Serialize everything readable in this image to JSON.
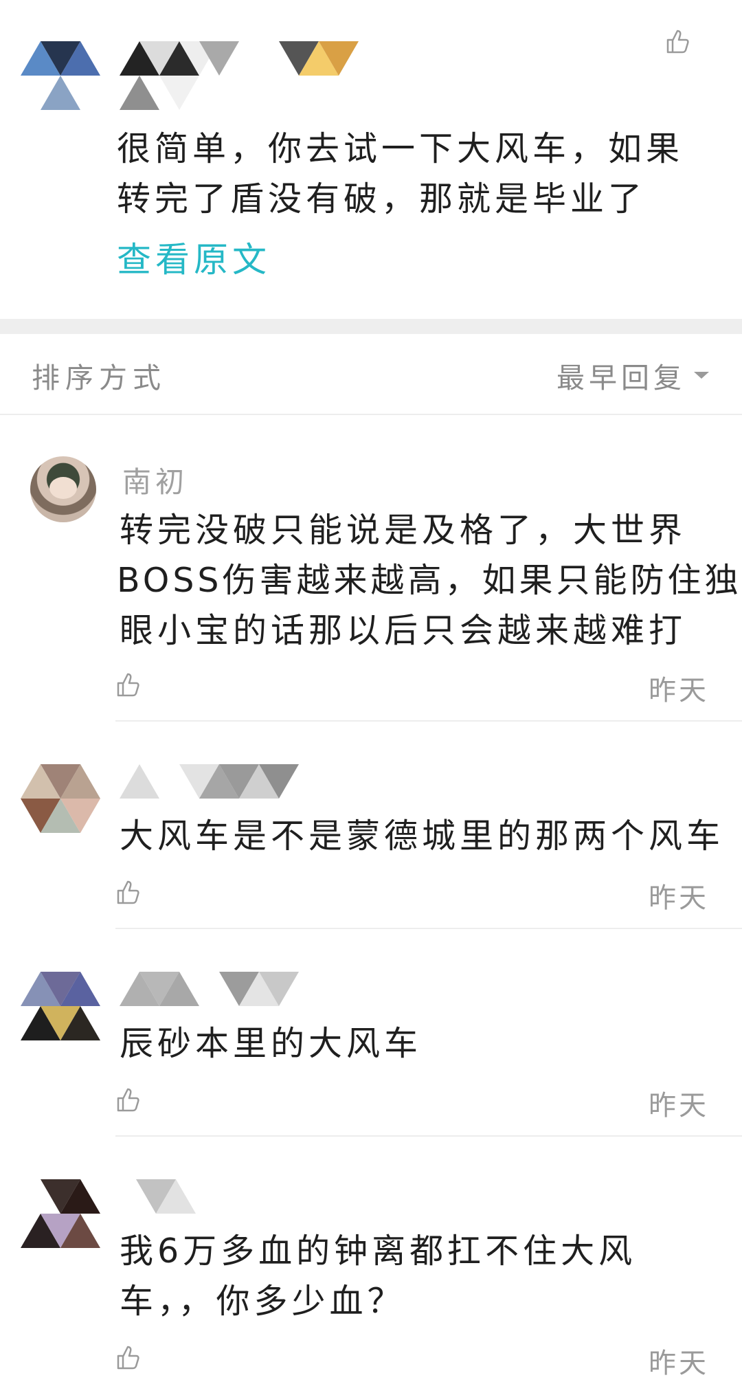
{
  "op": {
    "text_line1": "很简单，你去试一下大风车，如果",
    "text_line2": "转完了盾没有破，那就是毕业了",
    "view_original": "查看原文"
  },
  "sort_bar": {
    "label": "排序方式",
    "selected": "最早回复"
  },
  "replies": [
    {
      "username": "南初",
      "line1": "转完没破只能说是及格了，大世界",
      "line2": "BOSS伤害越来越高，如果只能防住独",
      "line3": "眼小宝的话那以后只会越来越难打",
      "time": "昨天"
    },
    {
      "line1": "大风车是不是蒙德城里的那两个风车",
      "time": "昨天"
    },
    {
      "line1": "辰砂本里的大风车",
      "time": "昨天"
    },
    {
      "line1": "我6万多血的钟离都扛不住大风",
      "line2": "车，，你多少血？",
      "time": "昨天"
    }
  ],
  "colors": {
    "accent": "#25b8c6",
    "muted": "#9a9a9a",
    "divider": "#ededed"
  }
}
